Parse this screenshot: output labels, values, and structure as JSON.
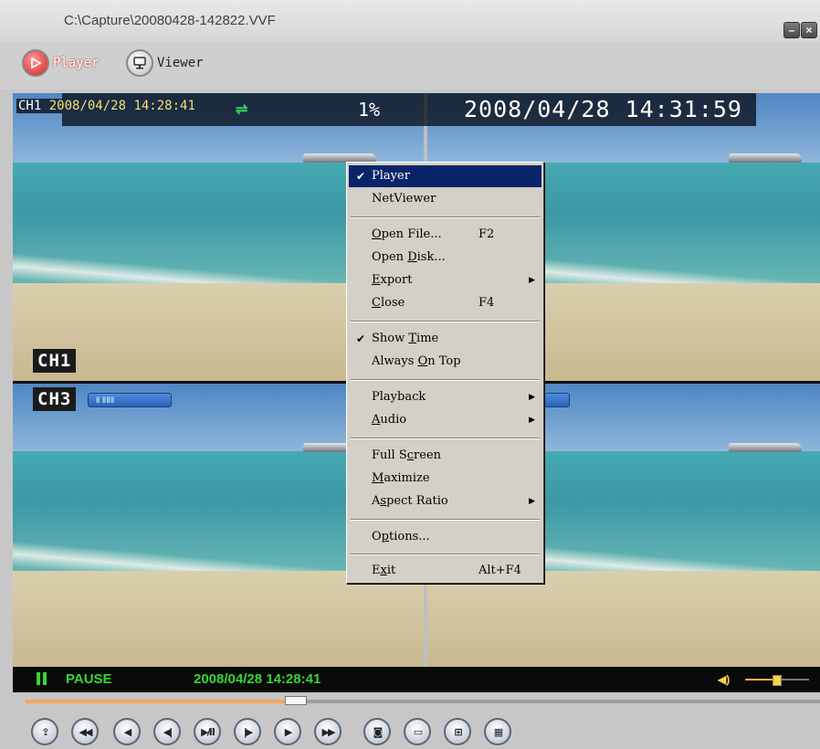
{
  "window": {
    "title": "C:\\Capture\\20080428-142822.VVF",
    "minimize_glyph": "–",
    "close_glyph": "×"
  },
  "modes": {
    "player": {
      "label": "Player",
      "icon": "play-icon"
    },
    "viewer": {
      "label": "Viewer",
      "icon": "monitor-icon"
    }
  },
  "osd": {
    "channel": "CH1",
    "start_time": "2008/04/28 14:28:41",
    "percent": "1%",
    "current_time": "2008/04/28 14:31:59"
  },
  "cameras": [
    {
      "label": "CH1"
    },
    {
      "label": "CH3",
      "chip": "Ⅱ ⅡⅡⅡ"
    }
  ],
  "status": {
    "state": "PAUSE",
    "time": "2008/04/28 14:28:41",
    "volume_fraction": 0.43
  },
  "progress": {
    "fraction": 0.34
  },
  "controls": [
    {
      "name": "export-button",
      "icon": "export-icon",
      "glyph": "⇪"
    },
    {
      "name": "fast-rewind-button",
      "icon": "fast-rewind-icon",
      "glyph": "◀◀"
    },
    {
      "name": "rewind-button",
      "icon": "rewind-icon",
      "glyph": "◀"
    },
    {
      "name": "step-back-button",
      "icon": "step-back-icon",
      "glyph": "◀|"
    },
    {
      "name": "play-pause-button",
      "icon": "play-pause-icon",
      "glyph": "▶/Ⅱ"
    },
    {
      "name": "step-forward-button",
      "icon": "step-forward-icon",
      "glyph": "|▶"
    },
    {
      "name": "forward-button",
      "icon": "forward-icon",
      "glyph": "▶"
    },
    {
      "name": "fast-forward-button",
      "icon": "fast-forward-icon",
      "glyph": "▶▶"
    },
    {
      "name": "snapshot-button",
      "icon": "camera-icon",
      "glyph": "◙"
    },
    {
      "name": "single-view-button",
      "icon": "single-view-icon",
      "glyph": "▭"
    },
    {
      "name": "quad-view-button",
      "icon": "quad-view-icon",
      "glyph": "⊞"
    },
    {
      "name": "nine-view-button",
      "icon": "nine-view-icon",
      "glyph": "▦"
    }
  ],
  "menu": {
    "items": [
      {
        "label": "Player",
        "checked": true,
        "selected": true
      },
      {
        "label": "NetViewer"
      },
      {
        "label": "Open File...",
        "underline": "O",
        "shortcut": "F2"
      },
      {
        "label": "Open Disk...",
        "underline": "D"
      },
      {
        "label": "Export",
        "underline": "E",
        "submenu": true
      },
      {
        "label": "Close",
        "underline": "C",
        "shortcut": "F4"
      },
      {
        "label": "Show Time",
        "underline": "T",
        "checked": true
      },
      {
        "label": "Always On Top",
        "underline": "O"
      },
      {
        "label": "Playback",
        "submenu": true
      },
      {
        "label": "Audio",
        "underline": "A",
        "submenu": true
      },
      {
        "label": "Full Screen",
        "underline": "c"
      },
      {
        "label": "Maximize",
        "underline": "M"
      },
      {
        "label": "Aspect Ratio",
        "underline": "s",
        "submenu": true
      },
      {
        "label": "Options...",
        "underline": "p"
      },
      {
        "label": "Exit",
        "underline": "x",
        "shortcut": "Alt+F4"
      }
    ],
    "check_glyph": "✔",
    "submenu_glyph": "▶"
  },
  "colors": {
    "menu_highlight": "#0a246a",
    "status_text": "#34d634",
    "osd_yellow": "#f5e06c",
    "progress_fill": "#f0a85c"
  }
}
